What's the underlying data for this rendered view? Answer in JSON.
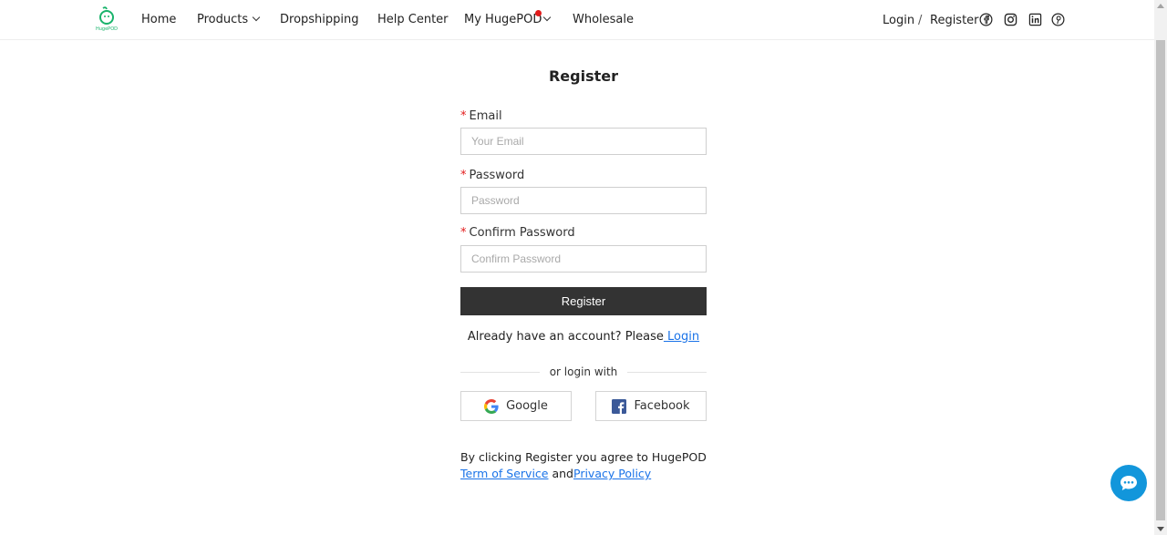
{
  "header": {
    "logo_text": "HugePOD",
    "nav": {
      "home": "Home",
      "products": "Products",
      "dropshipping": "Dropshipping",
      "help_center": "Help Center",
      "my_hugepod": "My HugePOD",
      "wholesale": "Wholesale"
    },
    "login": "Login",
    "separator": "/",
    "register": "Register",
    "social_icons": [
      "facebook-icon",
      "instagram-icon",
      "linkedin-icon",
      "pinterest-icon"
    ]
  },
  "form": {
    "title": "Register",
    "email_label": "Email",
    "email_placeholder": "Your Email",
    "password_label": "Password",
    "password_placeholder": "Password",
    "confirm_label": "Confirm Password",
    "confirm_placeholder": "Confirm Password",
    "required_mark": "*",
    "submit_label": "Register",
    "already_text": "Already have an account? Please",
    "login_link": " Login",
    "or_text": "or login with",
    "google_label": "Google",
    "facebook_label": "Facebook",
    "terms_text": "By clicking Register you agree to HugePOD",
    "terms_link": "Term of Service",
    "and_text": " and",
    "privacy_link": "Privacy Policy"
  },
  "colors": {
    "brand_green": "#19b36b",
    "button_dark": "#333333",
    "link_blue": "#1a73e8",
    "chat_blue": "#1296db",
    "required_red": "#e21b1b"
  }
}
